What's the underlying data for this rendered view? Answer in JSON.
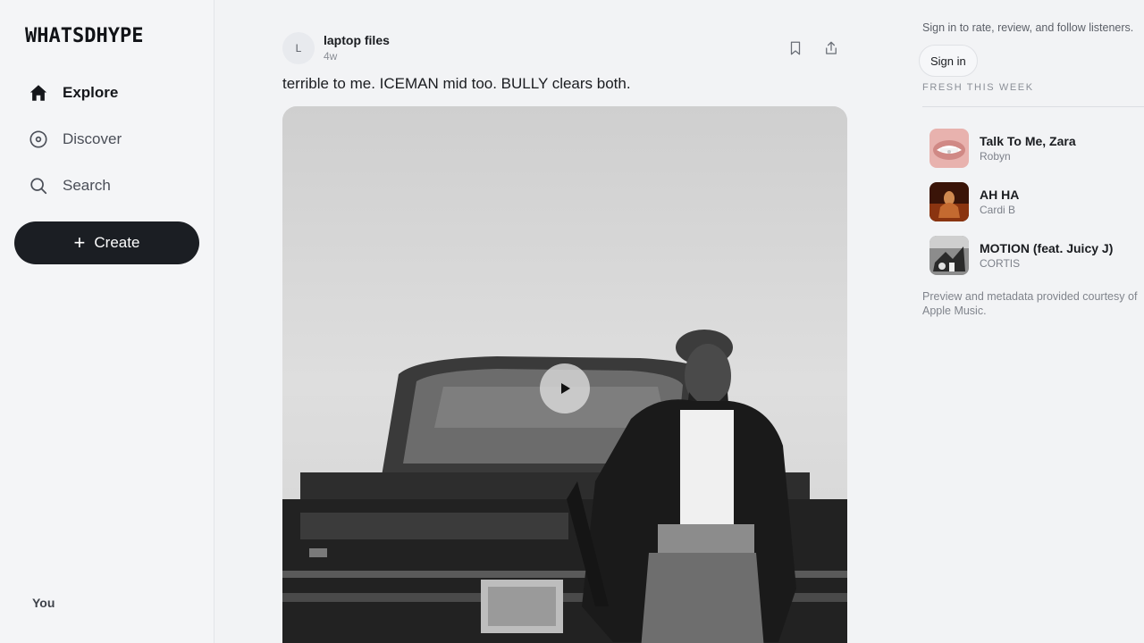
{
  "app": {
    "logo": "WHATSDHYPE"
  },
  "sidebar": {
    "items": [
      {
        "label": "Explore",
        "icon": "home-icon",
        "active": true
      },
      {
        "label": "Discover",
        "icon": "disc-icon",
        "active": false
      },
      {
        "label": "Search",
        "icon": "search-icon",
        "active": false
      }
    ],
    "create_label": "Create",
    "you_label": "You"
  },
  "post": {
    "avatar_letter": "L",
    "author": "laptop files",
    "time": "4w",
    "text": "terrible to me. ICEMAN mid too. BULLY clears both.",
    "media": {
      "type": "album-cover-preview",
      "style": "black-and-white photo"
    }
  },
  "right": {
    "signin_prompt": "Sign in to rate, review, and follow listeners.",
    "signin_label": "Sign in",
    "section_title": "FRESH THIS WEEK",
    "tracks": [
      {
        "title": "Talk To Me, Zara",
        "artist": "Robyn"
      },
      {
        "title": "AH HA",
        "artist": "Cardi B"
      },
      {
        "title": "MOTION (feat. Juicy J)",
        "artist": "CORTIS"
      }
    ],
    "courtesy": "Preview and metadata provided courtesy of Apple Music."
  },
  "colors": {
    "accent_dark": "#1b1e23",
    "background": "#f2f3f5",
    "text_muted": "#8a8e96"
  }
}
